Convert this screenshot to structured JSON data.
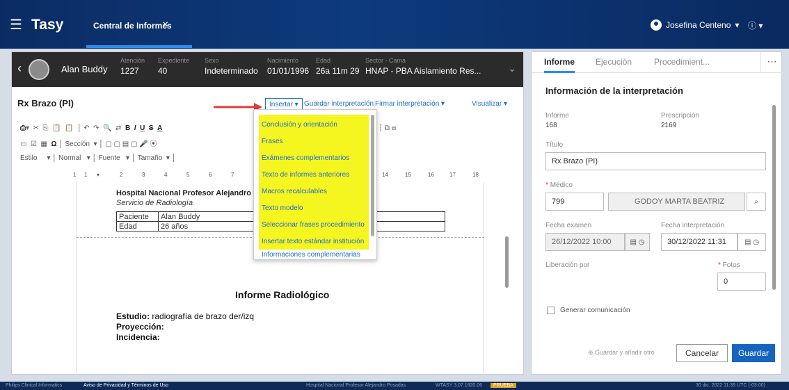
{
  "app": {
    "title": "Tasy",
    "tab": "Central de Informes"
  },
  "user": {
    "name": "Josefina Centeno"
  },
  "patient": {
    "name": "Alan Buddy",
    "fields": [
      {
        "label": "Atención",
        "value": "1227"
      },
      {
        "label": "Expediente",
        "value": "40"
      },
      {
        "label": "Sexo",
        "value": "Indeterminado"
      },
      {
        "label": "Nacimiento",
        "value": "01/01/1996"
      },
      {
        "label": "Edad",
        "value": "26a 11m 29"
      },
      {
        "label": "Sector - Cama",
        "value": "HNAP - PBA Aislamiento Res..."
      }
    ]
  },
  "editor": {
    "doc_title": "Rx Brazo (PI)",
    "menus": {
      "insertar": "Insertar",
      "guardar": "Guardar interpretación",
      "firmar": "Firmar interpretación",
      "visualizar": "Visualizar"
    },
    "toolbar": {
      "seccion": "Sección",
      "estilo": "Estilo",
      "normal": "Normal",
      "fuente": "Fuente",
      "tamano": "Tamaño"
    },
    "ruler": [
      "1",
      "1",
      "2",
      "3",
      "4",
      "5",
      "6",
      "7",
      "14",
      "15",
      "16",
      "17",
      "18"
    ]
  },
  "insert_menu": {
    "items": [
      "Conclusión y orientación",
      "Frases",
      "Exámenes complementarios",
      "Texto de informes anteriores",
      "Macros recalculables",
      "Texto modelo",
      "Seleccionar frases procedimiento",
      "Insertar texto estándar institución"
    ],
    "extra": "Informaciones complementarias",
    "highlight_color": "#f5f51f"
  },
  "document": {
    "hospital": "Hospital Nacional Profesor Alejandro Posada",
    "service": "Servicio de Radiología",
    "table": [
      [
        "Paciente",
        "Alan Buddy"
      ],
      [
        "Edad",
        "26 años"
      ]
    ],
    "report_title": "Informe Radiológico",
    "estudio_label": "Estudio:",
    "estudio_value": "radiografía de brazo der/izq",
    "proyeccion_label": "Proyección:",
    "incidencia_label": "Incidencia:"
  },
  "panel": {
    "tabs": [
      "Informe",
      "Ejecución",
      "Procedimient..."
    ],
    "section_title": "Información de la interpretación",
    "informe_label": "Informe",
    "informe_value": "168",
    "prescripcion_label": "Prescripción",
    "prescripcion_value": "2169",
    "titulo_label": "Título",
    "titulo_value": "Rx Brazo (PI)",
    "medico_label": "Médico",
    "medico_code": "799",
    "medico_name": "GODOY MARTA BEATRIZ",
    "fecha_examen_label": "Fecha examen",
    "fecha_examen_value": "26/12/2022 10:00",
    "fecha_interp_label": "Fecha interpretación",
    "fecha_interp_value": "30/12/2022 11:31",
    "liberacion_label": "Liberación por",
    "fotos_label": "Fotos",
    "fotos_value": "0",
    "generar_label": "Generar comunicación",
    "add_other": "Guardar y añadir otro",
    "cancel": "Cancelar",
    "save": "Guardar"
  },
  "footer": {
    "company": "Philips Clinical Informatics",
    "privacy": "Aviso de Privacidad y Términos de Uso",
    "hospital": "Hospital Nacional Profesor Alejandro Posadas",
    "version": "WTASY 3.07.1820.06",
    "env": "PRUEBA",
    "datetime": "30 dic. 2022   11:35   UTC (-03:00)"
  },
  "colors": {
    "topbar": "#0d3a7d",
    "accent": "#2c8cf0",
    "link": "#1d6fd0",
    "save": "#1565c0",
    "required": "#e03030"
  }
}
